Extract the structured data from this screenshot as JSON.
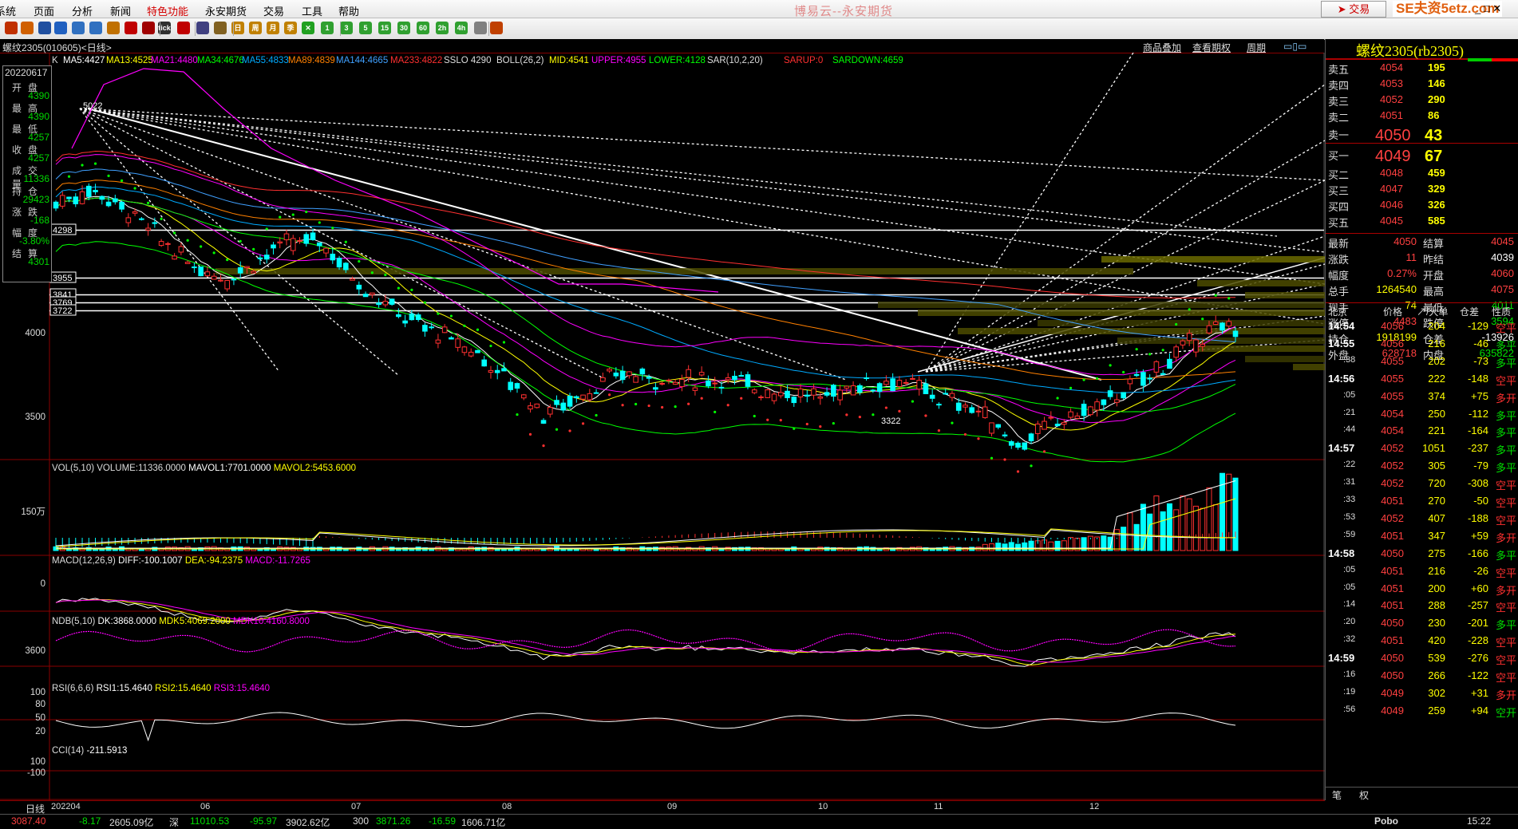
{
  "menubar": {
    "items": [
      "系统",
      "页面",
      "分析",
      "新闻",
      "特色功能",
      "永安期货",
      "交易",
      "工具",
      "帮助"
    ],
    "title": "博易云--永安期货",
    "trade": "交易",
    "watermark": "SE夫资5etz.com",
    "winctl": "_ □ ✕"
  },
  "toolbar": {
    "buttons": [
      {
        "icon": "back-icon",
        "color": "#c03000",
        "label": ""
      },
      {
        "icon": "home-icon",
        "color": "#d06000",
        "label": ""
      },
      {
        "icon": "grid-icon",
        "color": "#2050a0",
        "label": ""
      },
      {
        "icon": "list-icon",
        "color": "#2060c0",
        "label": ""
      },
      {
        "icon": "zoom-in-icon",
        "color": "#3070c0",
        "label": ""
      },
      {
        "icon": "zoom-out-icon",
        "color": "#3070c0",
        "label": ""
      },
      {
        "icon": "search-icon",
        "color": "#c07000",
        "label": ""
      },
      {
        "icon": "pen-icon",
        "color": "#c00000",
        "label": ""
      },
      {
        "icon": "draw-icon",
        "color": "#a00000",
        "label": ""
      },
      {
        "icon": "tick-icon",
        "color": "#303030",
        "label": "tick"
      },
      {
        "icon": "filter-icon",
        "color": "#c00000",
        "label": ""
      },
      {
        "icon": "split-icon",
        "color": "#404080",
        "label": ""
      },
      {
        "icon": "table-icon",
        "color": "#806020",
        "label": ""
      },
      {
        "icon": "day-icon",
        "color": "#c08000",
        "label": "日"
      },
      {
        "icon": "week-icon",
        "color": "#c08000",
        "label": "周"
      },
      {
        "icon": "month-icon",
        "color": "#c08000",
        "label": "月"
      },
      {
        "icon": "season-icon",
        "color": "#c08000",
        "label": "季"
      },
      {
        "icon": "custom-icon",
        "color": "#20a020",
        "label": "✕"
      },
      {
        "icon": "m1-icon",
        "color": "#30a030",
        "label": "1"
      },
      {
        "icon": "m3-icon",
        "color": "#30a030",
        "label": "3"
      },
      {
        "icon": "m5-icon",
        "color": "#30a030",
        "label": "5"
      },
      {
        "icon": "m15-icon",
        "color": "#30a030",
        "label": "15"
      },
      {
        "icon": "m30-icon",
        "color": "#30a030",
        "label": "30"
      },
      {
        "icon": "h1-icon",
        "color": "#30a030",
        "label": "60"
      },
      {
        "icon": "h2-icon",
        "color": "#30a030",
        "label": "2h"
      },
      {
        "icon": "h4-icon",
        "color": "#30a030",
        "label": "4h"
      },
      {
        "icon": "lock-icon",
        "color": "#808080",
        "label": ""
      },
      {
        "icon": "calc-icon",
        "color": "#c04000",
        "label": ""
      }
    ]
  },
  "chart": {
    "symbol_title": "螺纹2305(010605)<日线>",
    "indicators": [
      {
        "text": "K",
        "color": "#ddd"
      },
      {
        "text": "MA5:4427",
        "color": "#ffffff"
      },
      {
        "text": "MA13:4525",
        "color": "#ffff00"
      },
      {
        "text": "MA21:4480",
        "color": "#ff00ff"
      },
      {
        "text": "MA34:4676",
        "color": "#00ff00"
      },
      {
        "text": "MA55:4833",
        "color": "#00aaff"
      },
      {
        "text": "MA89:4839",
        "color": "#ff8000"
      },
      {
        "text": "MA144:4665",
        "color": "#40a0ff"
      },
      {
        "text": "MA233:4822",
        "color": "#ff3030"
      },
      {
        "text": "SSLO 4290",
        "color": "#ddd"
      },
      {
        "text": "BOLL(26,2)",
        "color": "#ddd"
      },
      {
        "text": "MID:4541",
        "color": "#ffff00"
      },
      {
        "text": "UPPER:4955",
        "color": "#ff00ff"
      },
      {
        "text": "LOWER:4128",
        "color": "#00ff00"
      },
      {
        "text": "SAR(10,2,20)",
        "color": "#ddd"
      },
      {
        "text": "SARUP:0",
        "color": "#ff3030"
      },
      {
        "text": "SARDOWN:4659",
        "color": "#00ff00"
      }
    ],
    "head_links": [
      "商品叠加",
      "查看期权",
      "周期"
    ],
    "price_axis": [
      "4000",
      "3500"
    ],
    "level_boxes": [
      "4298",
      "3955",
      "3841",
      "3769",
      "3722"
    ],
    "low_label": "3322",
    "high_label": "5022",
    "vol": {
      "label": "VOL(5,10)",
      "volume": "VOLUME:11336.0000",
      "mavol1": "MAVOL1:7701.0000",
      "mavol2": "MAVOL2:5453.6000",
      "axis": "150万"
    },
    "macd": {
      "label": "MACD(12,26,9)",
      "diff": "DIFF:-100.1007",
      "dea": "DEA:-94.2375",
      "macd": "MACD:-11.7265",
      "axis": "0"
    },
    "ndb": {
      "label": "NDB(5,10)",
      "dk": "DK:3868.0000",
      "mdk5": "MDK5:4069.2000",
      "mdk10": "MDK10:4160.8000",
      "axis": "3600"
    },
    "rsi": {
      "label": "RSI(6,6,6)",
      "rsi1": "RSI1:15.4640",
      "rsi2": "RSI2:15.4640",
      "rsi3": "RSI3:15.4640",
      "axis": [
        "100",
        "80",
        "50",
        "20"
      ]
    },
    "cci": {
      "label": "CCI(14)",
      "value": "-211.5913",
      "axis": [
        "100",
        "-100"
      ]
    },
    "time_axis": [
      "日线",
      "202204",
      "06",
      "07",
      "08",
      "09",
      "10",
      "11",
      "12"
    ]
  },
  "ohlc_box": [
    {
      "k": "",
      "v": "20220617"
    },
    {
      "k": "开盘",
      "v": "4390"
    },
    {
      "k": "最高",
      "v": "4390"
    },
    {
      "k": "最低",
      "v": "4257"
    },
    {
      "k": "收盘",
      "v": "4257"
    },
    {
      "k": "成交量",
      "v": "11336"
    },
    {
      "k": "持仓",
      "v": "29423"
    },
    {
      "k": "涨跌",
      "v": "-168"
    },
    {
      "k": "幅度",
      "v": "-3.80%"
    },
    {
      "k": "结算",
      "v": "4301"
    }
  ],
  "quote": {
    "title": "螺纹2305(rb2305)",
    "asks": [
      {
        "lbl": "卖五",
        "price": "4054",
        "vol": "195"
      },
      {
        "lbl": "卖四",
        "price": "4053",
        "vol": "146"
      },
      {
        "lbl": "卖三",
        "price": "4052",
        "vol": "290"
      },
      {
        "lbl": "卖二",
        "price": "4051",
        "vol": "86"
      },
      {
        "lbl": "卖一",
        "price": "4050",
        "vol": "43"
      }
    ],
    "bids": [
      {
        "lbl": "买一",
        "price": "4049",
        "vol": "67"
      },
      {
        "lbl": "买二",
        "price": "4048",
        "vol": "459"
      },
      {
        "lbl": "买三",
        "price": "4047",
        "vol": "329"
      },
      {
        "lbl": "买四",
        "price": "4046",
        "vol": "326"
      },
      {
        "lbl": "买五",
        "price": "4045",
        "vol": "585"
      }
    ],
    "stats": [
      {
        "l1": "最新",
        "v1": "4050",
        "c1": "#ff4040",
        "l2": "结算",
        "v2": "4045",
        "c2": "#ff4040"
      },
      {
        "l1": "涨跌",
        "v1": "11",
        "c1": "#ff4040",
        "l2": "昨结",
        "v2": "4039",
        "c2": "#ffffff"
      },
      {
        "l1": "幅度",
        "v1": "0.27%",
        "c1": "#ff4040",
        "l2": "开盘",
        "v2": "4060",
        "c2": "#ff4040"
      },
      {
        "l1": "总手",
        "v1": "1264540",
        "c1": "#ffff00",
        "l2": "最高",
        "v2": "4075",
        "c2": "#ff4040"
      },
      {
        "l1": "现手",
        "v1": "74",
        "c1": "#ffff00",
        "l2": "最低",
        "v2": "4011",
        "c2": "#00e000"
      },
      {
        "l1": "涨停",
        "v1": "4483",
        "c1": "#ff4040",
        "l2": "跌停",
        "v2": "3594",
        "c2": "#00e000"
      },
      {
        "l1": "持仓",
        "v1": "1918199",
        "c1": "#ffff00",
        "l2": "仓差",
        "v2": "-13926",
        "c2": "#ffffff"
      },
      {
        "l1": "外盘",
        "v1": "628718",
        "c1": "#ff4040",
        "l2": "内盘",
        "v2": "635822",
        "c2": "#00e000"
      }
    ],
    "tick_head": {
      "time": "北京",
      "price": "价格",
      "vol": "↗/大单",
      "oi": "仓差",
      "nature": "性质"
    },
    "ticks": [
      {
        "t": "14:54",
        "p": "4056",
        "v": "204",
        "d": "-129",
        "n": "空平",
        "nc": "#ff3030",
        "big": true
      },
      {
        "t": "14:55",
        "p": "4056",
        "v": "216",
        "d": "-46",
        "n": "多平",
        "nc": "#00e000",
        "big": true
      },
      {
        "t": ":38",
        "p": "4055",
        "v": "202",
        "d": "-73",
        "n": "多平",
        "nc": "#00e000",
        "big": false
      },
      {
        "t": "14:56",
        "p": "4055",
        "v": "222",
        "d": "-148",
        "n": "空平",
        "nc": "#ff3030",
        "big": true
      },
      {
        "t": ":05",
        "p": "4055",
        "v": "374",
        "d": "+75",
        "n": "多开",
        "nc": "#ff3030",
        "big": false
      },
      {
        "t": ":21",
        "p": "4054",
        "v": "250",
        "d": "-112",
        "n": "多平",
        "nc": "#00e000",
        "big": false
      },
      {
        "t": ":44",
        "p": "4054",
        "v": "221",
        "d": "-164",
        "n": "多平",
        "nc": "#00e000",
        "big": false
      },
      {
        "t": "14:57",
        "p": "4052",
        "v": "1051",
        "d": "-237",
        "n": "多平",
        "nc": "#00e000",
        "big": true
      },
      {
        "t": ":22",
        "p": "4052",
        "v": "305",
        "d": "-79",
        "n": "多平",
        "nc": "#00e000",
        "big": false
      },
      {
        "t": ":31",
        "p": "4052",
        "v": "720",
        "d": "-308",
        "n": "空平",
        "nc": "#ff3030",
        "big": false
      },
      {
        "t": ":33",
        "p": "4051",
        "v": "270",
        "d": "-50",
        "n": "空平",
        "nc": "#ff3030",
        "big": false
      },
      {
        "t": ":53",
        "p": "4052",
        "v": "407",
        "d": "-188",
        "n": "空平",
        "nc": "#ff3030",
        "big": false
      },
      {
        "t": ":59",
        "p": "4051",
        "v": "347",
        "d": "+59",
        "n": "多开",
        "nc": "#ff3030",
        "big": false
      },
      {
        "t": "14:58",
        "p": "4050",
        "v": "275",
        "d": "-166",
        "n": "多平",
        "nc": "#00e000",
        "big": true
      },
      {
        "t": ":05",
        "p": "4051",
        "v": "216",
        "d": "-26",
        "n": "空平",
        "nc": "#ff3030",
        "big": false
      },
      {
        "t": ":05",
        "p": "4051",
        "v": "200",
        "d": "+60",
        "n": "多开",
        "nc": "#ff3030",
        "big": false
      },
      {
        "t": ":14",
        "p": "4051",
        "v": "288",
        "d": "-257",
        "n": "空平",
        "nc": "#ff3030",
        "big": false
      },
      {
        "t": ":20",
        "p": "4050",
        "v": "230",
        "d": "-201",
        "n": "多平",
        "nc": "#00e000",
        "big": false
      },
      {
        "t": ":32",
        "p": "4051",
        "v": "420",
        "d": "-228",
        "n": "空平",
        "nc": "#ff3030",
        "big": false
      },
      {
        "t": "14:59",
        "p": "4050",
        "v": "539",
        "d": "-276",
        "n": "空平",
        "nc": "#ff3030",
        "big": true
      },
      {
        "t": ":16",
        "p": "4050",
        "v": "266",
        "d": "-122",
        "n": "空平",
        "nc": "#ff3030",
        "big": false
      },
      {
        "t": ":19",
        "p": "4049",
        "v": "302",
        "d": "+31",
        "n": "多开",
        "nc": "#ff3030",
        "big": false
      },
      {
        "t": ":56",
        "p": "4049",
        "v": "259",
        "d": "+94",
        "n": "空开",
        "nc": "#00e000",
        "big": false
      }
    ],
    "tabs": [
      "笔",
      "权"
    ]
  },
  "status": {
    "items": [
      {
        "t": "3087.40",
        "c": "#ff4040"
      },
      {
        "t": "-8.17",
        "c": "#00e000"
      },
      {
        "t": "2605.09亿",
        "c": "#dddddd"
      },
      {
        "t": "深",
        "c": "#dddddd"
      },
      {
        "t": "11010.53",
        "c": "#00e000"
      },
      {
        "t": "-95.97",
        "c": "#00e000"
      },
      {
        "t": "3902.62亿",
        "c": "#dddddd"
      },
      {
        "t": "300",
        "c": "#dddddd"
      },
      {
        "t": "3871.26",
        "c": "#00e000"
      },
      {
        "t": "-16.59",
        "c": "#00e000"
      },
      {
        "t": "1606.71亿",
        "c": "#dddddd"
      }
    ],
    "brand": "Pobo",
    "clock": "15:22"
  }
}
